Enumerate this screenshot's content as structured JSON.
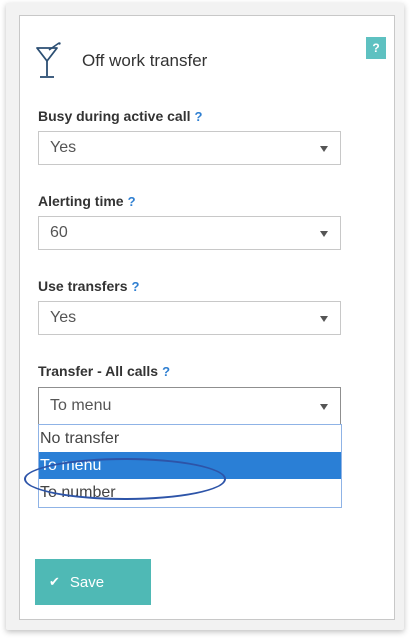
{
  "panel": {
    "title": "Off work transfer",
    "help_corner": "?"
  },
  "fields": [
    {
      "label": "Busy during active call",
      "help": "?",
      "value": "Yes"
    },
    {
      "label": "Alerting time",
      "help": "?",
      "value": "60"
    },
    {
      "label": "Use transfers",
      "help": "?",
      "value": "Yes"
    },
    {
      "label": "Transfer - All calls",
      "help": "?",
      "value": "To menu"
    }
  ],
  "dropdown": {
    "options": [
      "No transfer",
      "To menu",
      "To number"
    ],
    "highlighted": "To menu"
  },
  "actions": {
    "save_label": "Save",
    "save_icon": "check-icon"
  },
  "colors": {
    "accent": "#4fb9b5",
    "help_link": "#2f7fd1",
    "selection": "#2a7fd6",
    "annotation": "#2d54a8"
  },
  "icons": {
    "title_icon": "cocktail-glass-icon"
  }
}
